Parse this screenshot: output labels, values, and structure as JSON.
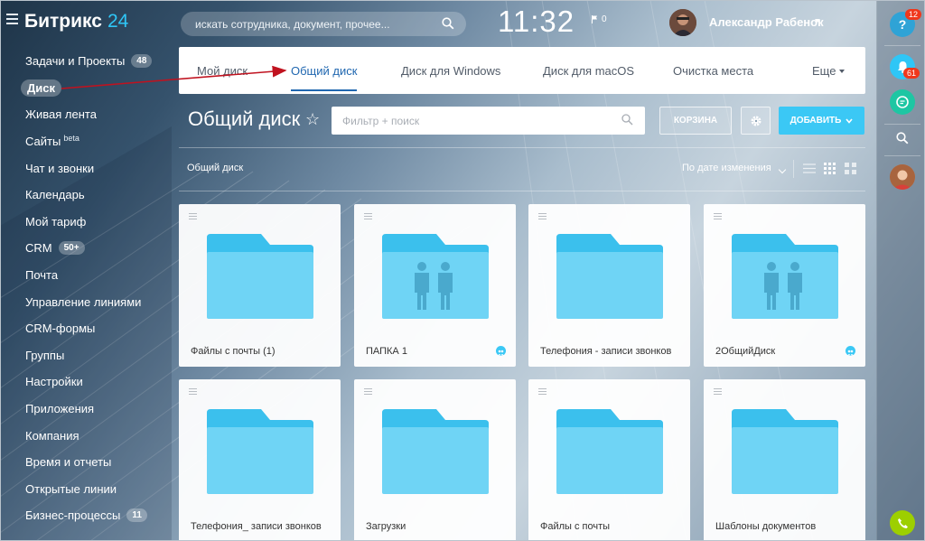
{
  "app": {
    "logo_text": "Битрикс",
    "logo_num": "24"
  },
  "header": {
    "search_placeholder": "искать сотрудника, документ, прочее...",
    "clock": "11:32",
    "flag_count": "0",
    "user_name": "Александр Рабенок"
  },
  "sidebar": {
    "items": [
      {
        "label": "Задачи и Проекты",
        "badge": "48"
      },
      {
        "label": "Диск",
        "active": true
      },
      {
        "label": "Живая лента"
      },
      {
        "label": "Сайты",
        "sup": "beta"
      },
      {
        "label": "Чат и звонки"
      },
      {
        "label": "Календарь"
      },
      {
        "label": "Мой тариф"
      },
      {
        "label": "CRM",
        "badge": "50+"
      },
      {
        "label": "Почта"
      },
      {
        "label": "Управление линиями"
      },
      {
        "label": "CRM-формы"
      },
      {
        "label": "Группы"
      },
      {
        "label": "Настройки"
      },
      {
        "label": "Приложения"
      },
      {
        "label": "Компания"
      },
      {
        "label": "Время и отчеты"
      },
      {
        "label": "Открытые линии"
      },
      {
        "label": "Бизнес-процессы",
        "badge": "11"
      }
    ]
  },
  "tabs": [
    {
      "label": "Мой диск"
    },
    {
      "label": "Общий диск",
      "active": true
    },
    {
      "label": "Диск для Windows"
    },
    {
      "label": "Диск для macOS"
    },
    {
      "label": "Очистка места"
    },
    {
      "label": "Еще"
    }
  ],
  "toolbar": {
    "page_title": "Общий диск",
    "star": "☆",
    "filter_placeholder": "Фильтр + поиск",
    "trash_label": "КОРЗИНА",
    "add_label": "ДОБАВИТЬ"
  },
  "breadcrumb": "Общий диск",
  "sort_label": "По дате изменения",
  "tiles": [
    {
      "name": "Файлы с почты (1)",
      "shared": false
    },
    {
      "name": "ПАПКА 1",
      "shared": true
    },
    {
      "name": "Телефония - записи звонков",
      "shared": false
    },
    {
      "name": "2ОбщийДиск",
      "shared": true
    },
    {
      "name": "Телефония_ записи звонков",
      "shared": false
    },
    {
      "name": "Загрузки",
      "shared": false
    },
    {
      "name": "Файлы с почты",
      "shared": false
    },
    {
      "name": "Шаблоны документов",
      "shared": false
    }
  ],
  "rail": {
    "help_badge": "12",
    "notify_badge": "61"
  },
  "colors": {
    "accent": "#3bc8f5",
    "active_tab": "#2067b0",
    "folder": "#6fd4f5",
    "folder_tab": "#3bc0ed",
    "annotation_arrow": "#c0121f",
    "phone": "#9dcf00"
  },
  "icons": {
    "menu": "hamburger-icon",
    "search": "magnifier-icon",
    "flag": "flag-icon",
    "gear": "gear-icon",
    "shared": "people-icon"
  }
}
